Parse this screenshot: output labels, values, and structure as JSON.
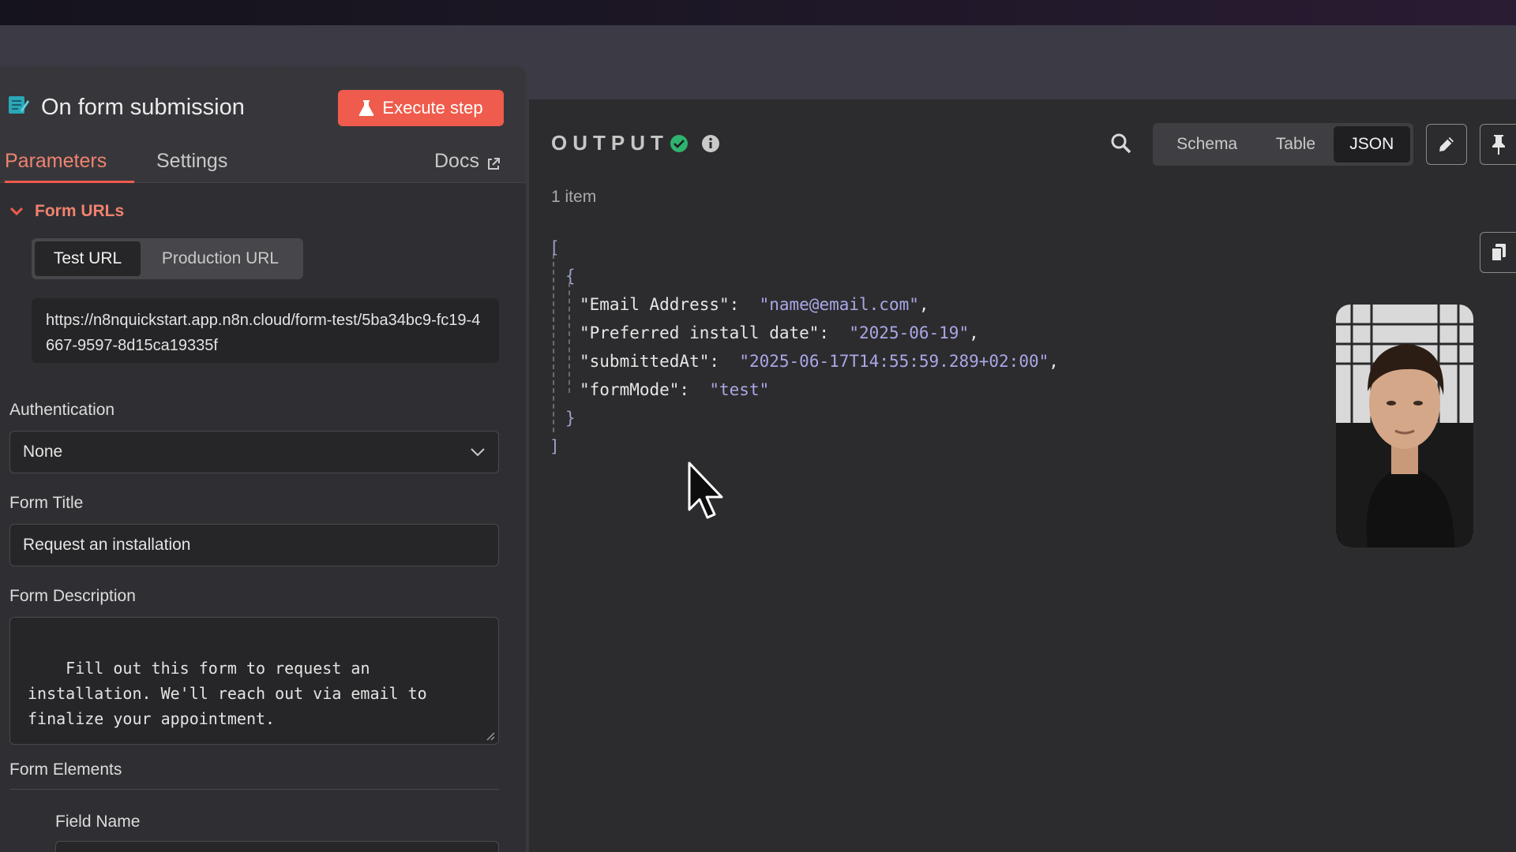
{
  "node": {
    "title": "On form submission",
    "execute_label": "Execute step",
    "tabs": [
      {
        "label": "Parameters",
        "active": true
      },
      {
        "label": "Settings",
        "active": false
      }
    ],
    "docs_label": "Docs"
  },
  "form_urls": {
    "section_label": "Form URLs",
    "options": [
      {
        "label": "Test URL",
        "active": true
      },
      {
        "label": "Production URL",
        "active": false
      }
    ],
    "url": "https://n8nquickstart.app.n8n.cloud/form-test/5ba34bc9-fc19-4667-9597-8d15ca19335f"
  },
  "authentication": {
    "label": "Authentication",
    "value": "None"
  },
  "form_title": {
    "label": "Form Title",
    "value": "Request an installation"
  },
  "form_description": {
    "label": "Form Description",
    "value": "Fill out this form to request an\ninstallation. We'll reach out via email to\nfinalize your appointment."
  },
  "form_elements": {
    "label": "Form Elements",
    "field_name_label": "Field Name"
  },
  "output": {
    "title": "OUTPUT",
    "item_count": "1 item",
    "views": [
      {
        "label": "Schema",
        "active": false
      },
      {
        "label": "Table",
        "active": false
      },
      {
        "label": "JSON",
        "active": true
      }
    ],
    "json": {
      "open_array": "[",
      "open_obj": "{",
      "close_obj": "}",
      "close_array": "]",
      "fields": [
        {
          "key": "\"Email Address\":",
          "value": "\"name@email.com\"",
          "comma": ","
        },
        {
          "key": "\"Preferred install date\":",
          "value": "\"2025-06-19\"",
          "comma": ","
        },
        {
          "key": "\"submittedAt\":",
          "value": "\"2025-06-17T14:55:59.289+02:00\"",
          "comma": ","
        },
        {
          "key": "\"formMode\":",
          "value": "\"test\"",
          "comma": ""
        }
      ]
    }
  },
  "colors": {
    "accent": "#ef5b4c",
    "accent_text": "#f0826f",
    "success": "#2fb36e",
    "json_value": "#a9a7e6"
  },
  "icons": [
    "form-node-icon",
    "flask-icon",
    "external-link-icon",
    "chevron-down-icon",
    "check-circle-icon",
    "info-icon",
    "search-icon",
    "pencil-icon",
    "pin-icon",
    "copy-icon",
    "mouse-pointer-icon"
  ]
}
